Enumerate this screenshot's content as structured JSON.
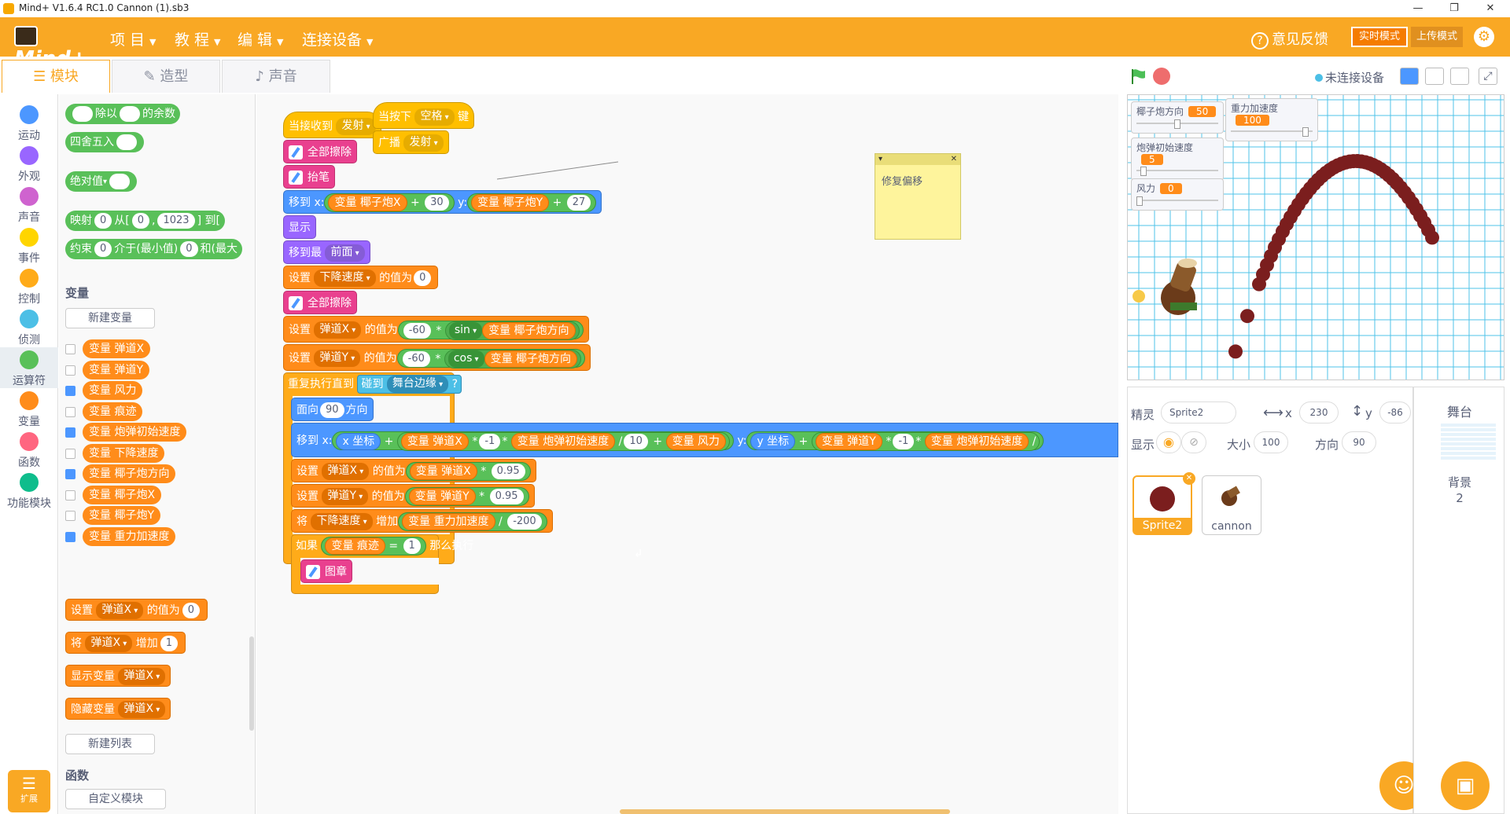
{
  "window": {
    "title": "Mind+ V1.6.4 RC1.0    Cannon (1).sb3",
    "min": "—",
    "max": "❐",
    "close": "✕"
  },
  "menubar": {
    "brand": "Mind+",
    "menus": [
      "项 目",
      "教 程",
      "编 辑",
      "连接设备"
    ],
    "feedback": "意见反馈",
    "mode_live": "实时模式",
    "mode_upload": "上传模式"
  },
  "tabs": {
    "blocks": "模块",
    "costumes": "造型",
    "sounds": "声音"
  },
  "stage_toolbar": {
    "device_status": "未连接设备"
  },
  "categories": [
    {
      "label": "运动",
      "color": "#4c97ff"
    },
    {
      "label": "外观",
      "color": "#9966ff"
    },
    {
      "label": "声音",
      "color": "#cf63cf"
    },
    {
      "label": "事件",
      "color": "#ffd500"
    },
    {
      "label": "控制",
      "color": "#ffab19"
    },
    {
      "label": "侦测",
      "color": "#4cbfe6"
    },
    {
      "label": "运算符",
      "color": "#59c059"
    },
    {
      "label": "变量",
      "color": "#ff8c1a"
    },
    {
      "label": "函数",
      "color": "#ff6680"
    },
    {
      "label": "功能模块",
      "color": "#0fbd8c"
    }
  ],
  "extension_label": "扩展",
  "palette": {
    "op_mod_a": "除以",
    "op_mod_b": "的余数",
    "op_round": "四舍五入",
    "op_abs": "绝对值",
    "op_map_a": "映射",
    "op_map_v1": "0",
    "op_map_b": "从[",
    "op_map_v2": "0",
    "op_map_sep": ",",
    "op_map_v3": "1023",
    "op_map_c": "] 到[",
    "op_constrain_a": "约束",
    "op_constrain_v1": "0",
    "op_constrain_b": "介于(最小值)",
    "op_constrain_v2": "0",
    "op_constrain_c": "和(最大",
    "section_variables": "变量",
    "btn_new_variable": "新建变量",
    "variables": [
      {
        "label": "变量 弹道X",
        "checked": false
      },
      {
        "label": "变量 弹道Y",
        "checked": false
      },
      {
        "label": "变量 风力",
        "checked": true
      },
      {
        "label": "变量 痕迹",
        "checked": false
      },
      {
        "label": "变量 炮弹初始速度",
        "checked": true
      },
      {
        "label": "变量 下降速度",
        "checked": false
      },
      {
        "label": "变量 椰子炮方向",
        "checked": true
      },
      {
        "label": "变量 椰子炮X",
        "checked": false
      },
      {
        "label": "变量 椰子炮Y",
        "checked": false
      },
      {
        "label": "变量 重力加速度",
        "checked": true
      }
    ],
    "set_a": "设置",
    "set_var": "弹道X",
    "set_b": "的值为",
    "set_val": "0",
    "change_a": "将",
    "change_var": "弹道X",
    "change_b": "增加",
    "change_val": "1",
    "show_var_a": "显示变量",
    "show_var_v": "弹道X",
    "hide_var_a": "隐藏变量",
    "hide_var_v": "弹道X",
    "btn_new_list": "新建列表",
    "section_functions": "函数",
    "btn_custom_block": "自定义模块"
  },
  "script": {
    "hat1_a": "当接收到",
    "hat1_msg": "发射",
    "clear1": "全部擦除",
    "penup": "抬笔",
    "goto_a": "移到 x:",
    "goto_v1": "变量 椰子炮X",
    "plus": "+",
    "goto_n1": "30",
    "goto_b": "y:",
    "goto_v2": "变量 椰子炮Y",
    "goto_n2": "27",
    "show": "显示",
    "front_a": "移到最",
    "front_v": "前面",
    "set1_a": "设置",
    "set1_var": "下降速度",
    "set1_b": "的值为",
    "set1_val": "0",
    "clear2": "全部擦除",
    "set2_a": "设置",
    "set2_var": "弹道X",
    "set2_b": "的值为",
    "set2_n": "-60",
    "times": "*",
    "set2_fn": "sin",
    "set2_v": "变量 椰子炮方向",
    "set3_a": "设置",
    "set3_var": "弹道Y",
    "set3_b": "的值为",
    "set3_n": "-60",
    "set3_fn": "cos",
    "set3_v": "变量 椰子炮方向",
    "repeat_a": "重复执行直到",
    "touch_a": "碰到",
    "touch_v": "舞台边缘",
    "touch_q": "?",
    "point_a": "面向",
    "point_n": "90",
    "point_b": "方向",
    "goto2_a": "移到 x:",
    "goto2_xpos": "x 坐标",
    "goto2_v1": "变量 弹道X",
    "goto2_n1": "-1",
    "goto2_v2": "变量 炮弹初始速度",
    "div": "/",
    "goto2_n2": "10",
    "goto2_v3": "变量 风力",
    "goto2_b": "y:",
    "goto2_ypos": "y 坐标",
    "goto2_v4": "变量 弹道Y",
    "goto2_n3": "-1",
    "goto2_v5": "变量 炮弹初始速度",
    "set4_a": "设置",
    "set4_var": "弹道X",
    "set4_b": "的值为",
    "set4_v": "变量 弹道X",
    "set4_n": "0.95",
    "set5_a": "设置",
    "set5_var": "弹道Y",
    "set5_b": "的值为",
    "set5_v": "变量 弹道Y",
    "set5_n": "0.95",
    "change_a": "将",
    "change_var": "下降速度",
    "change_b": "增加",
    "change_v": "变量 重力加速度",
    "change_n": "-200",
    "if_a": "如果",
    "if_v": "变量 痕迹",
    "eq": "=",
    "if_n": "1",
    "if_b": "那么执行",
    "stamp": "图章",
    "loop_arrow": "↲",
    "hat2_a": "当按下",
    "hat2_key": "空格",
    "hat2_b": "键",
    "broadcast_a": "广播",
    "broadcast_v": "发射",
    "comment": "修复偏移"
  },
  "workspace_controls": {
    "undo": "↶",
    "redo": "↷",
    "crop": "⧉",
    "zoom_in": "+",
    "zoom_out": "−",
    "reset": "="
  },
  "monitors": [
    {
      "label": "椰子炮方向",
      "value": "50",
      "level": 0.5
    },
    {
      "label": "重力加速度",
      "value": "100",
      "level": 0.95
    },
    {
      "label": "炮弹初始速度",
      "value": "5",
      "level": 0.05
    },
    {
      "label": "风力",
      "value": "0",
      "level": 0.0
    }
  ],
  "sprite_info": {
    "sprite_label": "精灵",
    "sprite_name": "Sprite2",
    "x_label": "x",
    "x": "230",
    "y_label": "y",
    "y": "-86",
    "show_label": "显示",
    "size_label": "大小",
    "size": "100",
    "dir_label": "方向",
    "dir": "90",
    "sprites": [
      "Sprite2",
      "cannon"
    ]
  },
  "stage_pane": {
    "title": "舞台",
    "backdrops_label": "背景",
    "backdrops_count": "2"
  },
  "colors": {
    "accent": "#f9a824",
    "ball": "#7b1e1e"
  }
}
